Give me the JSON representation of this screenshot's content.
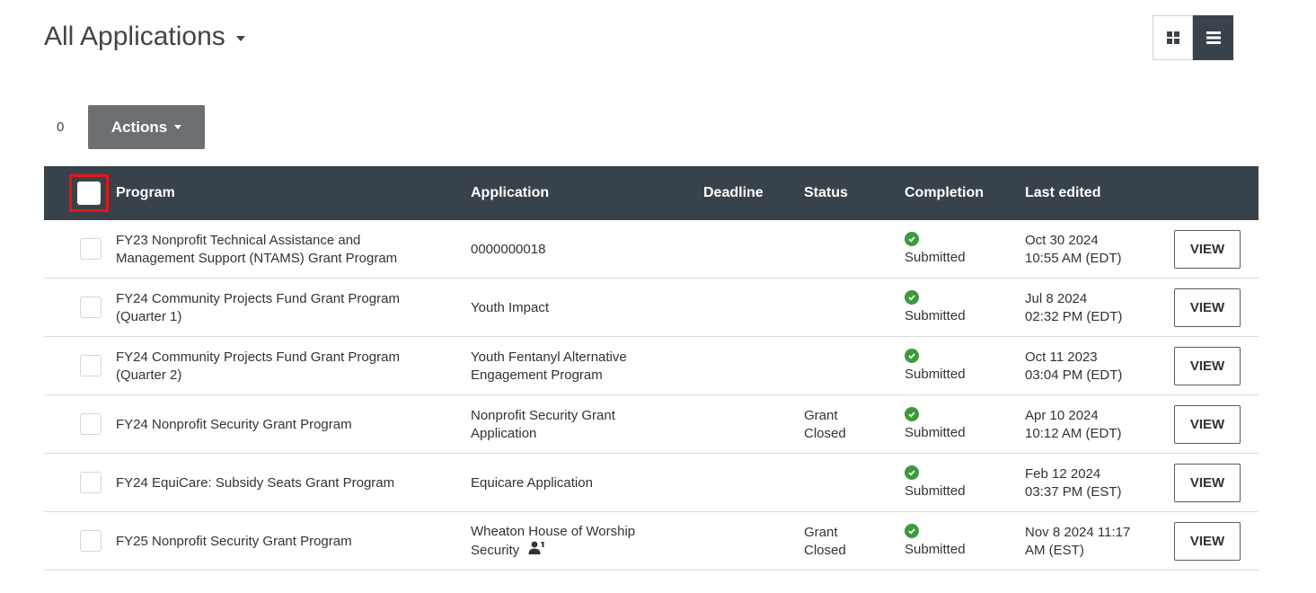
{
  "header": {
    "title": "All Applications"
  },
  "toolbar": {
    "selected_count": "0",
    "actions_label": "Actions"
  },
  "table": {
    "columns": {
      "program": "Program",
      "application": "Application",
      "deadline": "Deadline",
      "status": "Status",
      "completion": "Completion",
      "last_edited": "Last edited"
    },
    "rows": [
      {
        "program_line1": "FY23 Nonprofit Technical Assistance and",
        "program_line2": "Management Support (NTAMS) Grant Program",
        "application_line1": "0000000018",
        "application_line2": "",
        "deadline": "",
        "status_line1": "",
        "status_line2": "",
        "completion": "Submitted",
        "edited_line1": "Oct 30 2024",
        "edited_line2": "10:55 AM (EDT)",
        "view_label": "VIEW"
      },
      {
        "program_line1": "FY24 Community Projects Fund Grant Program",
        "program_line2": "(Quarter 1)",
        "application_line1": "Youth Impact",
        "application_line2": "",
        "deadline": "",
        "status_line1": "",
        "status_line2": "",
        "completion": "Submitted",
        "edited_line1": "Jul 8 2024",
        "edited_line2": "02:32 PM (EDT)",
        "view_label": "VIEW"
      },
      {
        "program_line1": "FY24 Community Projects Fund Grant Program",
        "program_line2": "(Quarter 2)",
        "application_line1": "Youth Fentanyl Alternative",
        "application_line2": "Engagement Program",
        "deadline": "",
        "status_line1": "",
        "status_line2": "",
        "completion": "Submitted",
        "edited_line1": "Oct 11 2023",
        "edited_line2": "03:04 PM (EDT)",
        "view_label": "VIEW"
      },
      {
        "program_line1": "FY24 Nonprofit Security Grant Program",
        "program_line2": "",
        "application_line1": "Nonprofit Security Grant",
        "application_line2": "Application",
        "deadline": "",
        "status_line1": "Grant",
        "status_line2": "Closed",
        "completion": "Submitted",
        "edited_line1": "Apr 10 2024",
        "edited_line2": "10:12 AM (EDT)",
        "view_label": "VIEW"
      },
      {
        "program_line1": "FY24 EquiCare: Subsidy Seats Grant Program",
        "program_line2": "",
        "application_line1": "Equicare Application",
        "application_line2": "",
        "deadline": "",
        "status_line1": "",
        "status_line2": "",
        "completion": "Submitted",
        "edited_line1": "Feb 12 2024",
        "edited_line2": "03:37 PM (EST)",
        "view_label": "VIEW"
      },
      {
        "program_line1": "FY25 Nonprofit Security Grant Program",
        "program_line2": "",
        "application_line1": "Wheaton House of Worship",
        "application_line2": "Security",
        "deadline": "",
        "status_line1": "Grant",
        "status_line2": "Closed",
        "completion": "Submitted",
        "edited_line1": "Nov 8 2024 11:17",
        "edited_line2": "AM (EST)",
        "view_label": "VIEW"
      }
    ]
  },
  "icons": {
    "grid_view": "grid-icon",
    "list_view": "list-icon",
    "completion": "check-circle-icon",
    "collaborator": "user-collaborator-icon"
  },
  "colors": {
    "header_bg": "#38424b",
    "actions_bg": "#6c6f72",
    "success": "#3a9b3a",
    "highlight": "#e8141a"
  }
}
